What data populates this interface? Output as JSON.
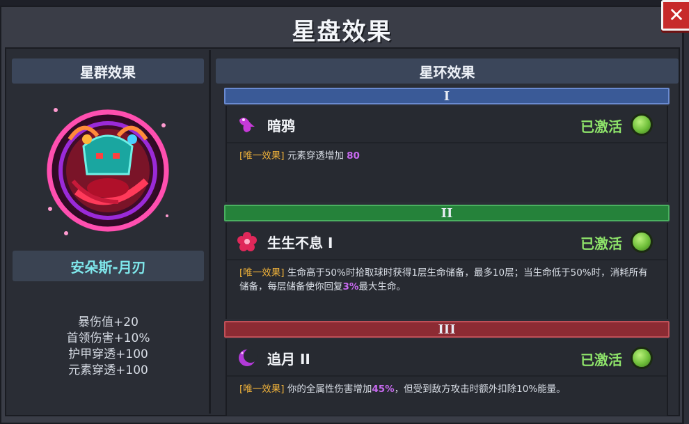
{
  "window": {
    "title": "星盘效果"
  },
  "left_panel": {
    "header": "星群效果",
    "constellation_name": "安朵斯-月刃",
    "stats": [
      "暴伤值+20",
      "首领伤害+10%",
      "护甲穿透+100",
      "元素穿透+100"
    ]
  },
  "right_panel": {
    "header": "星环效果",
    "rings": [
      {
        "numeral": "I",
        "header_color": "#3a5a97",
        "icon": "raven-icon",
        "name": "暗鸦",
        "status": "已激活",
        "tag": "[唯一效果]",
        "desc_1": " 元素穿透增加 ",
        "desc_hl_1": "80",
        "desc_2": "",
        "desc_hl_2": "",
        "desc_3": ""
      },
      {
        "numeral": "II",
        "header_color": "#25823a",
        "icon": "flower-icon",
        "name": "生生不息 I",
        "status": "已激活",
        "tag": "[唯一效果]",
        "desc_1": " 生命高于50%时拾取球时获得1层生命储备，最多10层；当生命低于50%时，消耗所有储备，每层储备使你回复",
        "desc_hl_1": "3%",
        "desc_2": "最大生命。",
        "desc_hl_2": "",
        "desc_3": ""
      },
      {
        "numeral": "III",
        "header_color": "#8c2b33",
        "icon": "crescent-moon-icon",
        "name": "追月 II",
        "status": "已激活",
        "tag": "[唯一效果]",
        "desc_1": " 你的全属性伤害增加",
        "desc_hl_1": "45%",
        "desc_2": "，但受到敌方攻击时额外扣除10%能量。",
        "desc_hl_2": "",
        "desc_3": ""
      }
    ]
  },
  "colors": {
    "active_green": "#8ee36a",
    "tag_orange": "#f0b23a",
    "highlight_purple": "#c86af0",
    "name_cyan": "#7fe8ec",
    "close_red": "#c72a2a"
  }
}
